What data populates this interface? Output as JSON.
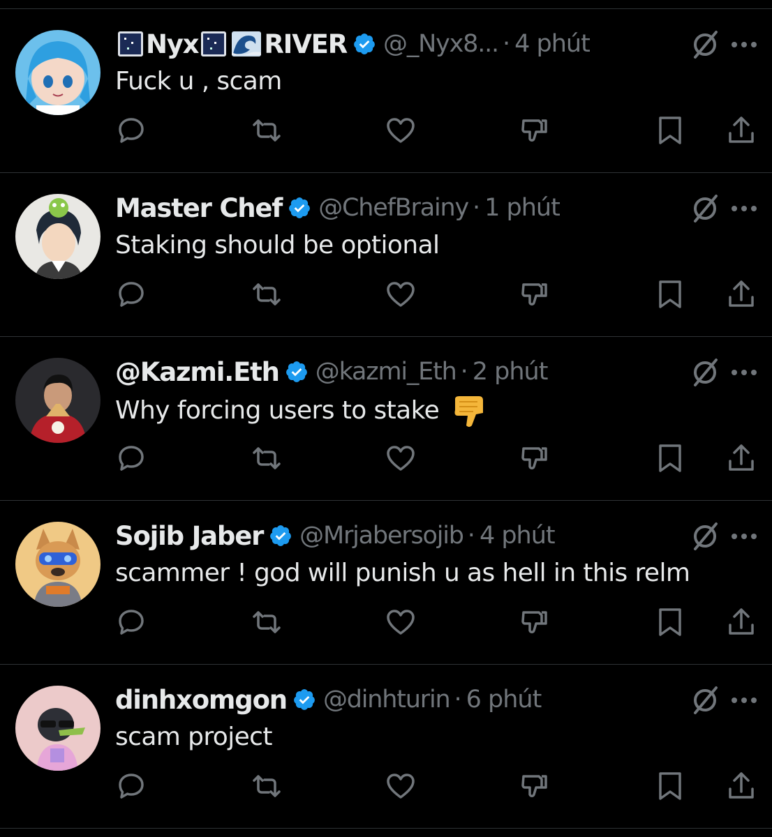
{
  "colors": {
    "background": "#000000",
    "text_primary": "#e7e9ea",
    "text_secondary": "#71767b",
    "divider": "#2f3336",
    "verified_blue": "#1d9bf0"
  },
  "action_icons": [
    "reply-icon",
    "repost-icon",
    "like-icon",
    "dislike-icon",
    "bookmark-icon",
    "share-icon"
  ],
  "tweets": [
    {
      "name_part1": "Nyx",
      "name_part2": "RIVER",
      "name_icons": [
        "night-sky-emoji",
        "night-sky-emoji",
        "wave-emoji"
      ],
      "verified": true,
      "handle": "@_Nyx8...",
      "separator": "·",
      "time": "4 phút",
      "text": "Fuck u , scam",
      "avatar": "anime-girl-blue-hair-avatar"
    },
    {
      "name": "Master Chef",
      "verified": true,
      "handle": "@ChefBrainy",
      "separator": "·",
      "time": "1 phút",
      "text": "Staking should be optional",
      "avatar": "anime-character-frog-hat-avatar"
    },
    {
      "name": "@Kazmi.Eth",
      "verified": true,
      "handle": "@kazmi_Eth",
      "separator": "·",
      "time": "2 phút",
      "text": "Why forcing users to stake",
      "text_emoji": "thumbs-down-emoji",
      "avatar": "iron-man-character-avatar"
    },
    {
      "name": "Sojib Jaber",
      "verified": true,
      "handle": "@Mrjabersojib",
      "separator": "·",
      "time": "4 phút",
      "text": "scammer ! god will punish u as hell in this relm",
      "avatar": "dog-with-blue-mask-avatar"
    },
    {
      "name": "dinhxomgon",
      "verified": true,
      "handle": "@dinhturin",
      "separator": "·",
      "time": "6 phút",
      "text": "scam project",
      "avatar": "cartoon-crow-avatar"
    }
  ]
}
